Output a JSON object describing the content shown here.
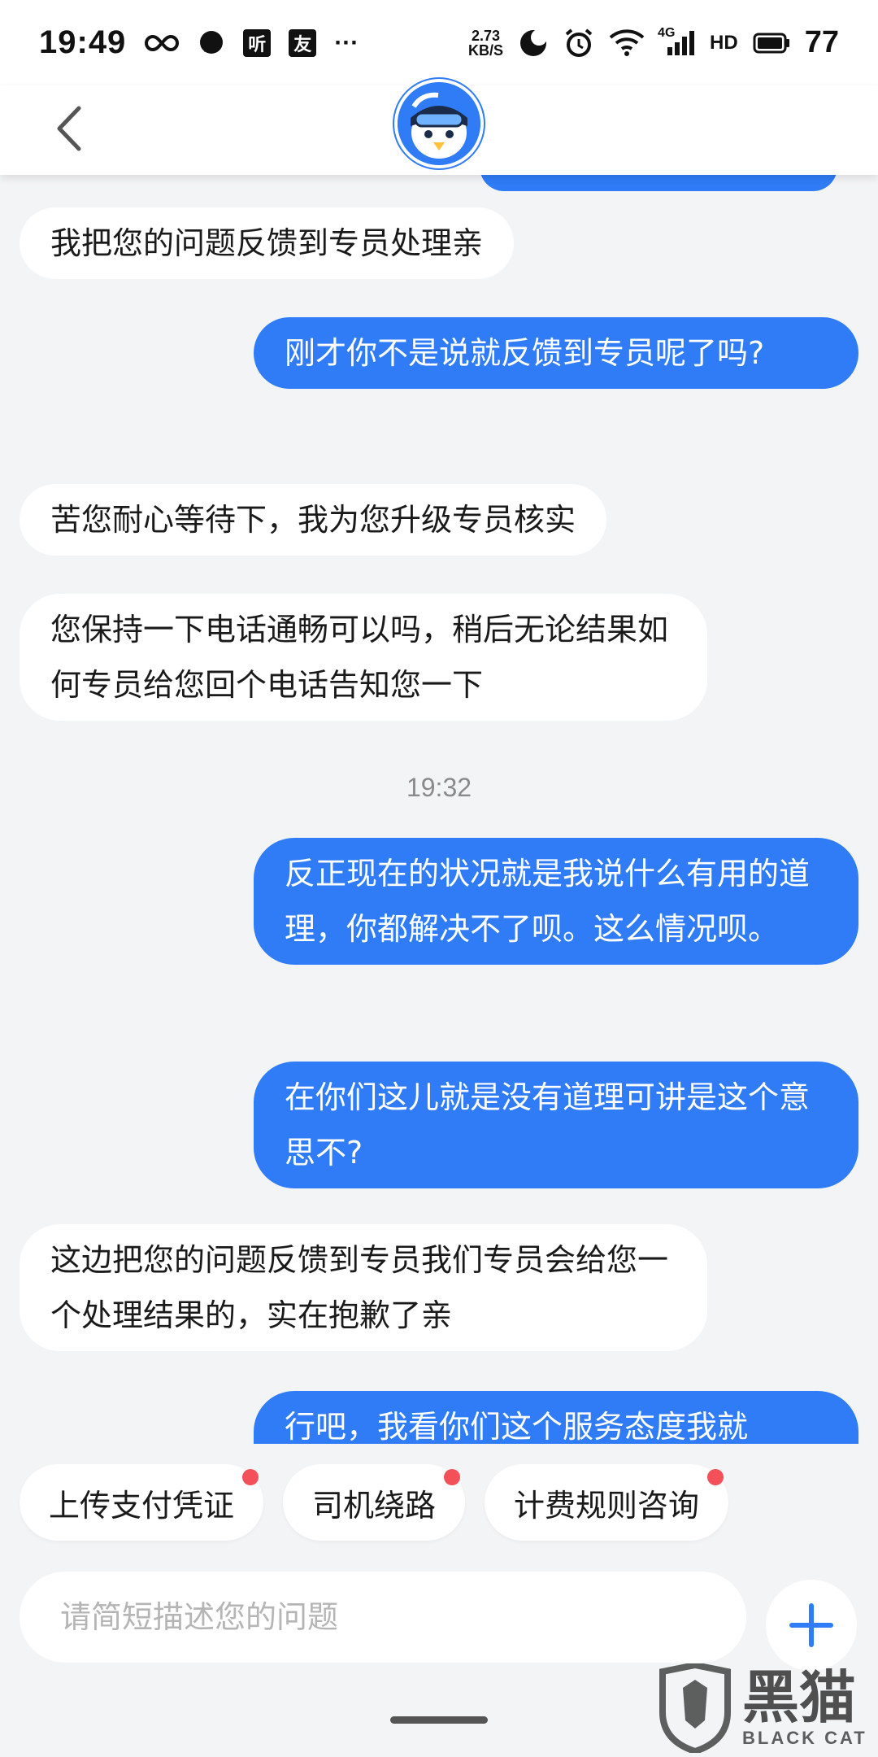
{
  "status_bar": {
    "time": "19:49",
    "net_speed_value": "2.73",
    "net_speed_unit": "KB/S",
    "network_type": "4G",
    "hd_label": "HD",
    "battery": "77",
    "app_icon_ting": "听",
    "app_icon_you": "友",
    "more_dots": "···"
  },
  "header": {
    "back_icon": "chevron-left-icon",
    "avatar_icon": "penguin-mascot-icon"
  },
  "messages": [
    {
      "side": "in",
      "text": "我把您的问题反馈到专员处理亲"
    },
    {
      "side": "out",
      "text": "刚才你不是说就反馈到专员呢了吗?"
    },
    {
      "side": "in",
      "text": "苦您耐心等待下，我为您升级专员核实"
    },
    {
      "side": "in",
      "text": "您保持一下电话通畅可以吗，稍后无论结果如何专员给您回个电话告知您一下"
    },
    {
      "side": "out",
      "text": "反正现在的状况就是我说什么有用的道理，你都解决不了呗。这么情况呗。"
    },
    {
      "side": "out",
      "text": "在你们这儿就是没有道理可讲是这个意思不?"
    },
    {
      "side": "in",
      "text": "这边把您的问题反馈到专员我们专员会给您一个处理结果的，实在抱歉了亲"
    },
    {
      "side": "out",
      "text": "行吧，我看你们这个服务态度我就"
    }
  ],
  "timestamp": "19:32",
  "quick_replies": [
    "上传支付凭证",
    "司机绕路",
    "计费规则咨询"
  ],
  "input": {
    "placeholder": "请简短描述您的问题"
  },
  "plus_icon": "plus-icon",
  "watermark": {
    "cn": "黑猫",
    "en": "BLACK CAT"
  },
  "colors": {
    "accent": "#2f7cf6",
    "background": "#f3f4f6",
    "badge": "#f4505a"
  }
}
